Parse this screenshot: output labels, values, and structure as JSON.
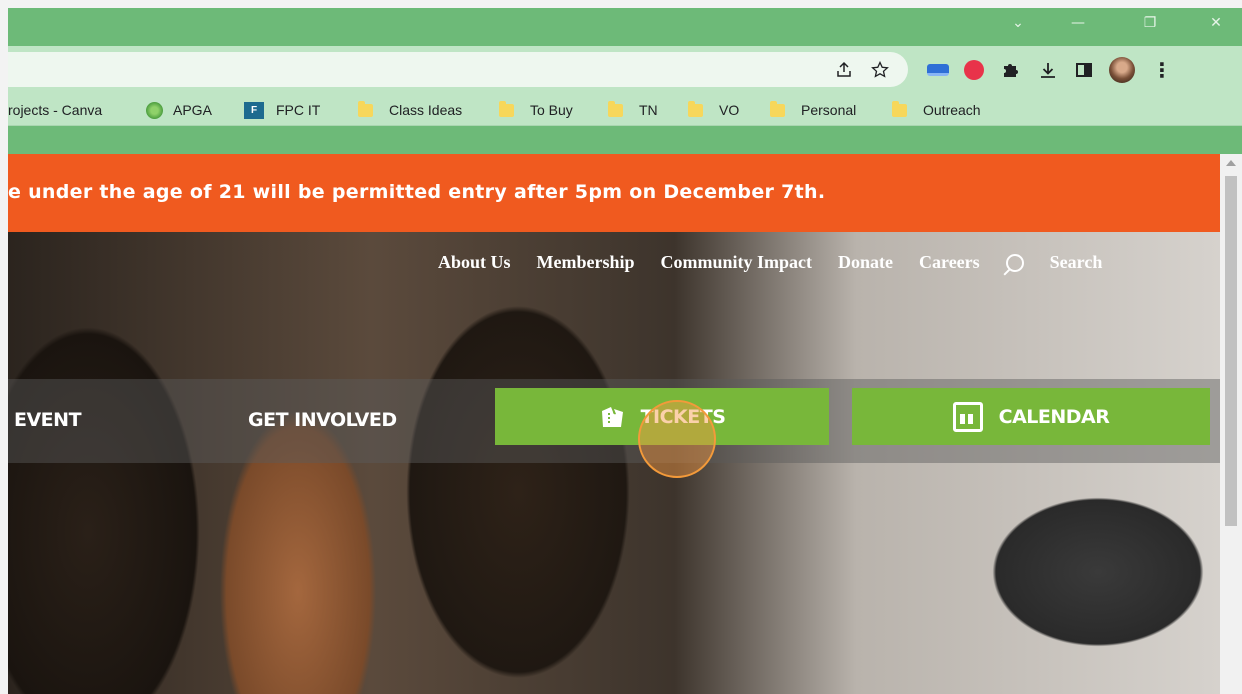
{
  "window": {
    "controls": {
      "dropdown": "⌄",
      "minimize": "—",
      "restore": "❐",
      "close": "✕"
    }
  },
  "toolbar": {
    "share_icon": "share-icon",
    "star_icon": "star-icon",
    "extensions": [
      "extension-blue-icon",
      "extension-red-icon",
      "puzzle-icon"
    ],
    "download_icon": "download-icon",
    "sidepanel_icon": "side-panel-icon",
    "avatar": "profile-avatar",
    "menu_icon": "⋮"
  },
  "bookmarks": [
    {
      "label": "rojects - Canva",
      "icon": "none"
    },
    {
      "label": "APGA",
      "icon": "apga-icon"
    },
    {
      "label": "FPC IT",
      "icon": "fpc-icon",
      "badge": "F"
    },
    {
      "label": "Class Ideas",
      "icon": "folder-icon"
    },
    {
      "label": "To Buy",
      "icon": "folder-icon"
    },
    {
      "label": "TN",
      "icon": "folder-icon"
    },
    {
      "label": "VO",
      "icon": "folder-icon"
    },
    {
      "label": "Personal",
      "icon": "folder-icon"
    },
    {
      "label": "Outreach",
      "icon": "folder-icon"
    }
  ],
  "alert": {
    "text": "e under the age of 21 will be permitted entry after 5pm on December 7th."
  },
  "topnav": {
    "items": [
      "About Us",
      "Membership",
      "Community Impact",
      "Donate",
      "Careers"
    ],
    "search_label": "Search"
  },
  "mainnav": {
    "event_label": "EVENT",
    "involved_label": "GET INVOLVED",
    "tickets_label": "TICKETS",
    "calendar_label": "CALENDAR"
  },
  "colors": {
    "chrome_frame": "#6dba78",
    "toolbar": "#bfe5c5",
    "alert_bg": "#f05a1f",
    "button_green": "#78b73a",
    "cursor_ring": "#f39a3a"
  }
}
